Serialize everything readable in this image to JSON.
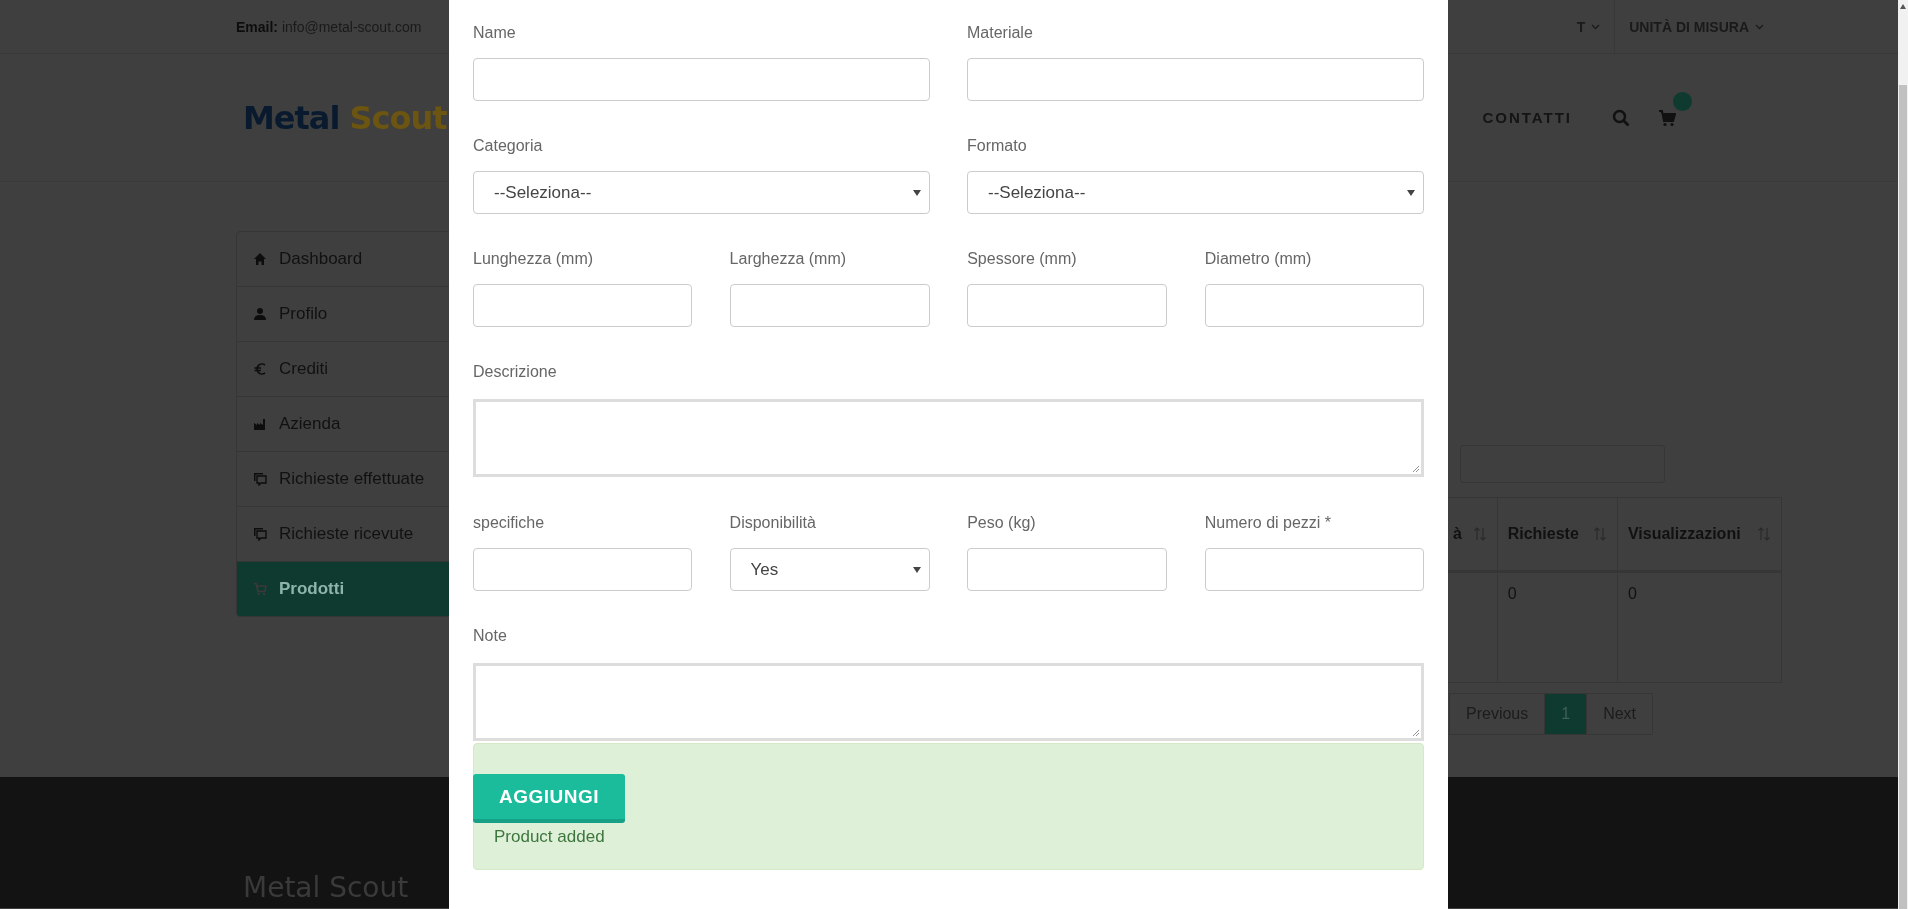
{
  "top_bar": {
    "email_label": "Email:",
    "email": "info@metal-scout.com",
    "menus": [
      {
        "label": "T"
      },
      {
        "label": "UNITÀ DI MISURA"
      }
    ]
  },
  "header": {
    "logo": {
      "word_1": "Metal",
      "word_2": "Scout"
    },
    "nav": [
      {
        "label": "CONTATTI"
      }
    ]
  },
  "sidebar": {
    "items": [
      {
        "label": "Dashboard",
        "kind": "home",
        "selected": false
      },
      {
        "label": "Profilo",
        "kind": "user",
        "selected": false
      },
      {
        "label": "Crediti",
        "kind": "euro",
        "selected": false
      },
      {
        "label": "Azienda",
        "kind": "factory",
        "selected": false
      },
      {
        "label": "Richieste effettuate",
        "kind": "chat",
        "selected": false
      },
      {
        "label": "Richieste ricevute",
        "kind": "chat",
        "selected": false
      },
      {
        "label": "Prodotti",
        "kind": "cart",
        "selected": true
      }
    ]
  },
  "table": {
    "columns": [
      {
        "label": "à"
      },
      {
        "label": "Richieste"
      },
      {
        "label": "Visualizzazioni"
      }
    ],
    "rows": [
      {
        "cells": [
          null,
          "0",
          "0"
        ]
      }
    ]
  },
  "pagination": {
    "previous": "Previous",
    "pages": [
      {
        "label": "1",
        "selected": true
      }
    ],
    "next": "Next"
  },
  "modal": {
    "rows": [
      {
        "fields": [
          {
            "label": "Name",
            "kind": "text"
          },
          {
            "label": "Materiale",
            "kind": "text"
          }
        ]
      },
      {
        "fields": [
          {
            "label": "Categoria",
            "kind": "select",
            "value": "--Seleziona--"
          },
          {
            "label": "Formato",
            "kind": "select",
            "value": "--Seleziona--"
          }
        ]
      },
      {
        "fields": [
          {
            "label": "Lunghezza (mm)",
            "kind": "text"
          },
          {
            "label": "Larghezza (mm)",
            "kind": "text"
          },
          {
            "label": "Spessore (mm)",
            "kind": "text"
          },
          {
            "label": "Diametro (mm)",
            "kind": "text"
          }
        ]
      },
      {
        "fields": [
          {
            "label": "Descrizione",
            "kind": "textarea"
          }
        ]
      },
      {
        "fields": [
          {
            "label": "specifiche",
            "kind": "text"
          },
          {
            "label": "Disponibilità",
            "kind": "select",
            "value": "Yes"
          },
          {
            "label": "Peso (kg)",
            "kind": "text"
          },
          {
            "label": "Numero di pezzi *",
            "kind": "text"
          }
        ]
      },
      {
        "fields": [
          {
            "label": "Note",
            "kind": "textarea"
          }
        ]
      }
    ],
    "alert": {
      "button": "AGGIUNGI",
      "message": "Product added"
    }
  },
  "footer": {
    "logo": "Metal Scout"
  }
}
